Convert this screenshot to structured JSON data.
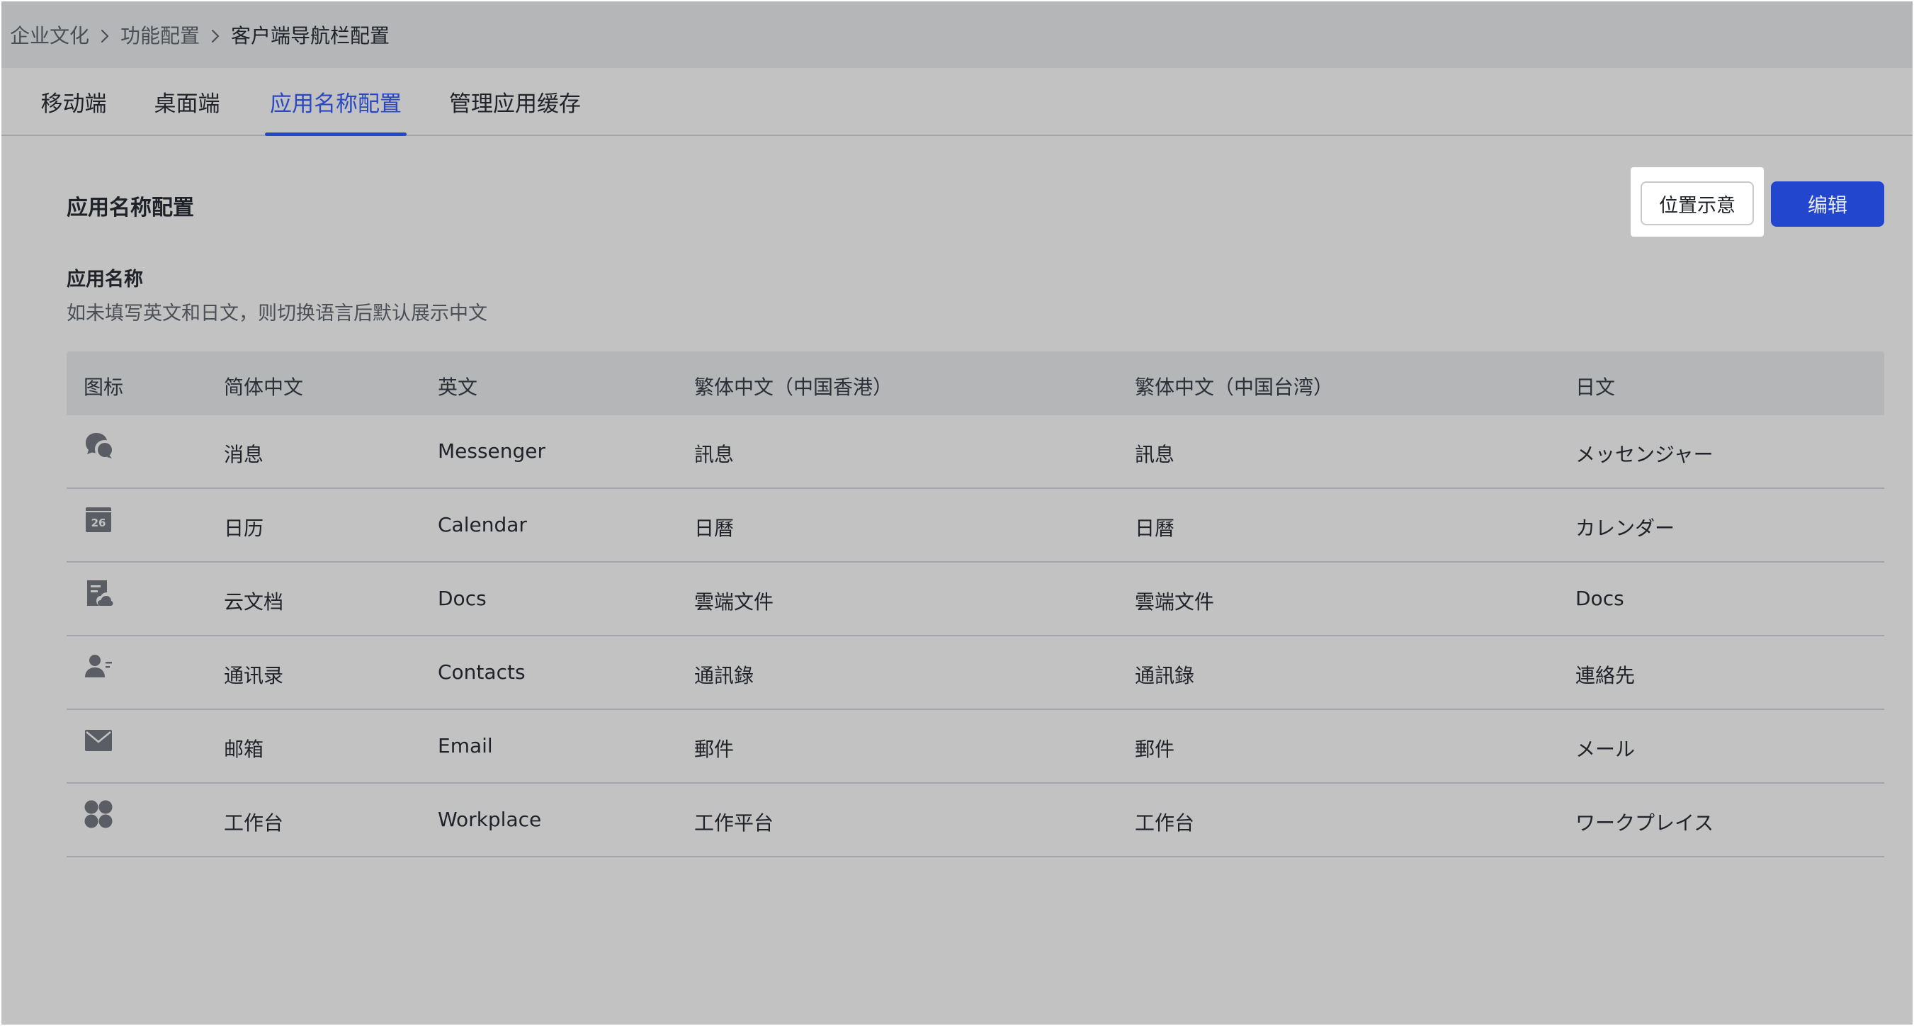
{
  "breadcrumb": {
    "items": [
      "企业文化",
      "功能配置",
      "客户端导航栏配置"
    ]
  },
  "tabs": [
    {
      "label": "移动端"
    },
    {
      "label": "桌面端"
    },
    {
      "label": "应用名称配置",
      "active": true
    },
    {
      "label": "管理应用缓存"
    }
  ],
  "section": {
    "title": "应用名称配置",
    "position_button": "位置示意",
    "edit_button": "编辑",
    "field_label": "应用名称",
    "field_hint": "如未填写英文和日文，则切换语言后默认展示中文"
  },
  "table": {
    "headers": [
      "图标",
      "简体中文",
      "英文",
      "繁体中文（中国香港）",
      "繁体中文（中国台湾）",
      "日文"
    ],
    "rows": [
      {
        "icon": "messenger-icon",
        "zh": "消息",
        "en": "Messenger",
        "hk": "訊息",
        "tw": "訊息",
        "ja": "メッセンジャー"
      },
      {
        "icon": "calendar-icon",
        "icon_text": "26",
        "zh": "日历",
        "en": "Calendar",
        "hk": "日曆",
        "tw": "日曆",
        "ja": "カレンダー"
      },
      {
        "icon": "docs-icon",
        "zh": "云文档",
        "en": "Docs",
        "hk": "雲端文件",
        "tw": "雲端文件",
        "ja": "Docs"
      },
      {
        "icon": "contacts-icon",
        "zh": "通讯录",
        "en": "Contacts",
        "hk": "通訊錄",
        "tw": "通訊錄",
        "ja": "連絡先"
      },
      {
        "icon": "email-icon",
        "zh": "邮箱",
        "en": "Email",
        "hk": "郵件",
        "tw": "郵件",
        "ja": "メール"
      },
      {
        "icon": "workplace-icon",
        "zh": "工作台",
        "en": "Workplace",
        "hk": "工作平台",
        "tw": "工作台",
        "ja": "ワークプレイス"
      }
    ]
  },
  "colors": {
    "accent": "#2346cf",
    "background": "#c2c2c2",
    "header_bar": "#b5b6b8"
  }
}
